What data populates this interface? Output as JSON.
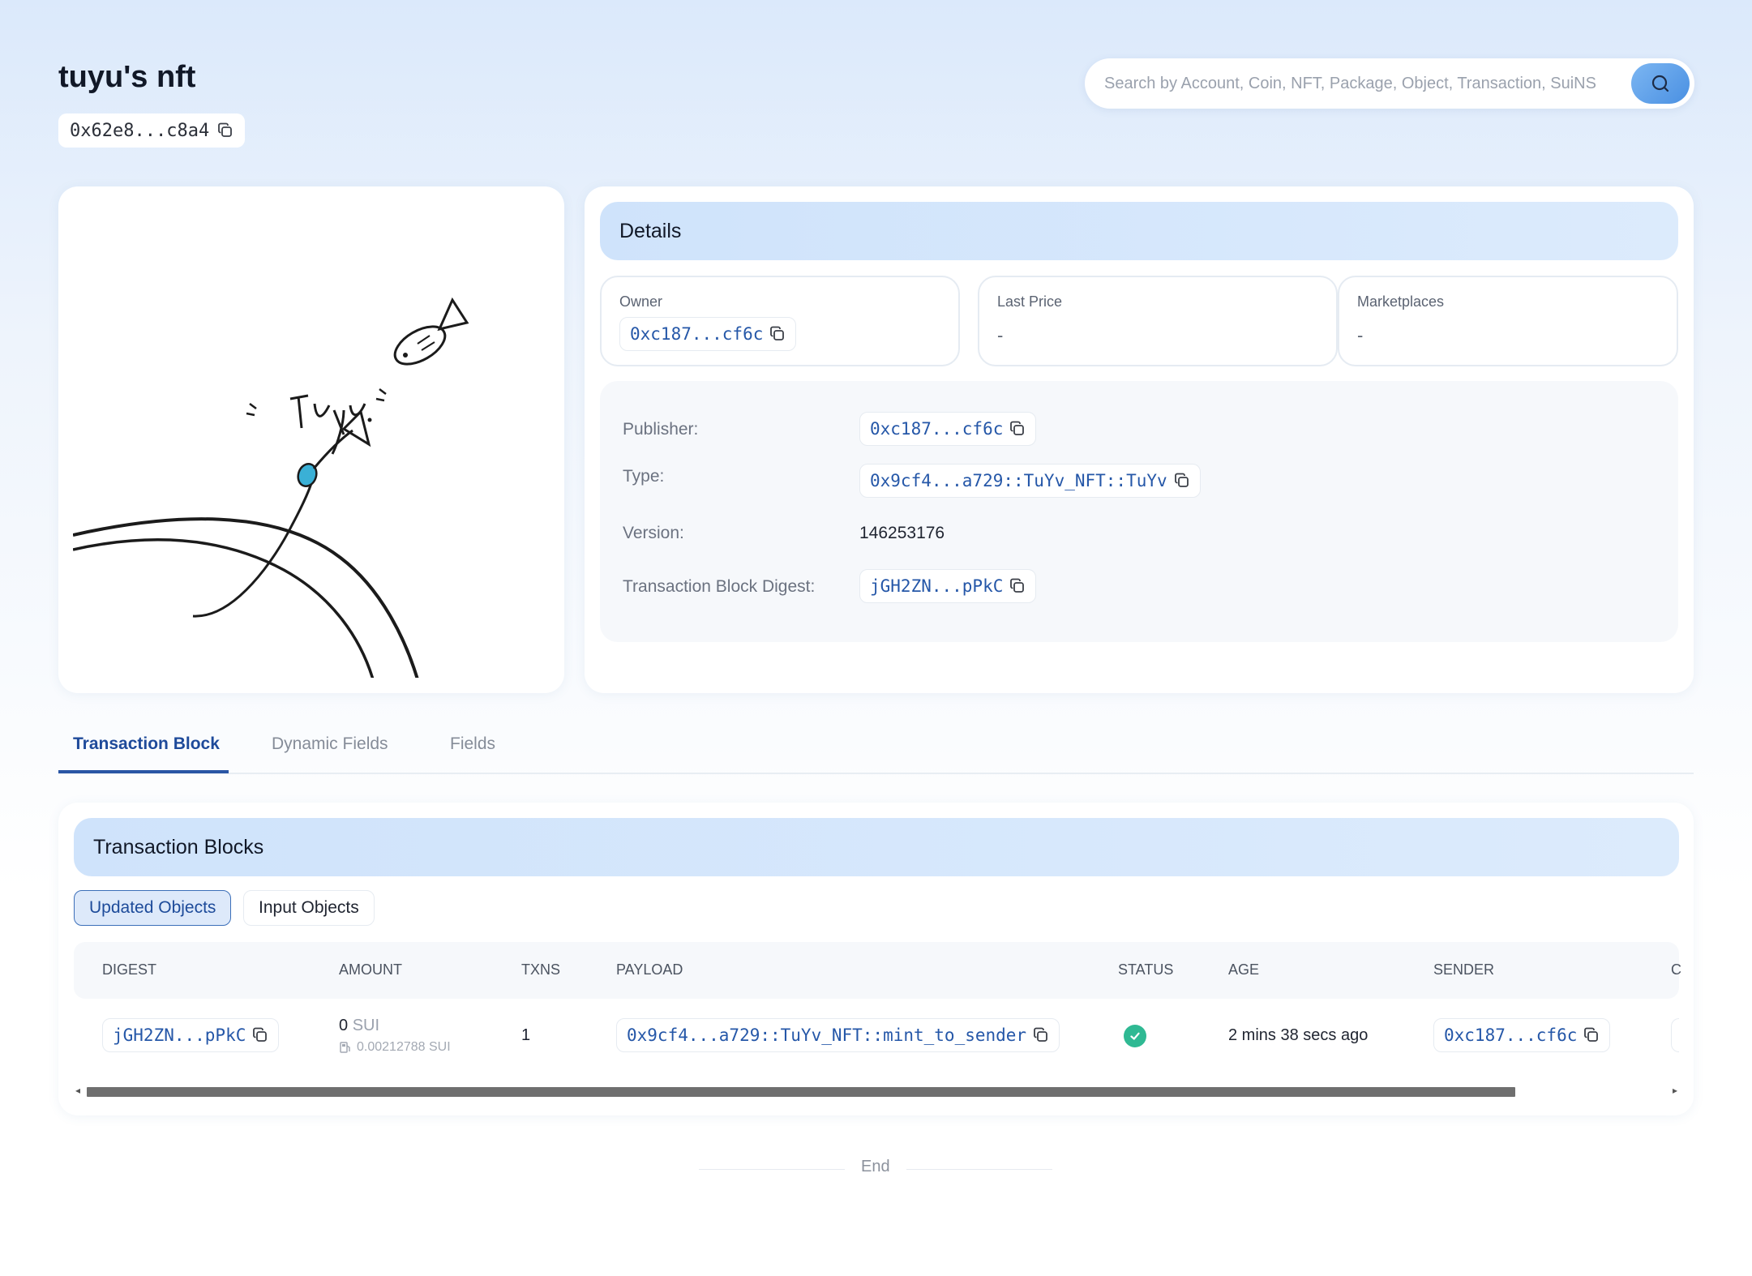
{
  "header": {
    "title": "tuyu's nft",
    "object_address": "0x62e8...c8a4",
    "search_placeholder": "Search by Account, Coin, NFT, Package, Object, Transaction, SuiNS"
  },
  "details": {
    "heading": "Details",
    "owner": {
      "label": "Owner",
      "value": "0xc187...cf6c"
    },
    "last_price": {
      "label": "Last Price",
      "value": "-"
    },
    "marketplaces": {
      "label": "Marketplaces",
      "value": "-"
    },
    "publisher": {
      "label": "Publisher:",
      "value": "0xc187...cf6c"
    },
    "type": {
      "label": "Type:",
      "value": "0x9cf4...a729::TuYv_NFT::TuYv"
    },
    "version": {
      "label": "Version:",
      "value": "146253176"
    },
    "digest": {
      "label": "Transaction Block Digest:",
      "value": "jGH2ZN...pPkC"
    }
  },
  "tabs": [
    "Transaction Block",
    "Dynamic Fields",
    "Fields"
  ],
  "transactions": {
    "heading": "Transaction Blocks",
    "filters": {
      "active": "Updated Objects",
      "inactive": "Input Objects"
    },
    "columns": [
      "DIGEST",
      "AMOUNT",
      "TXNS",
      "PAYLOAD",
      "STATUS",
      "AGE",
      "SENDER",
      "C"
    ],
    "rows": [
      {
        "digest": "jGH2ZN...pPkC",
        "amount": "0",
        "amount_unit": "SUI",
        "gas": "0.00212788 SUI",
        "txns": "1",
        "payload": "0x9cf4...a729::TuYv_NFT::mint_to_sender",
        "status": "success",
        "age": "2 mins 38 secs ago",
        "sender": "0xc187...cf6c"
      }
    ]
  },
  "footer": {
    "end_text": "End"
  },
  "colors": {
    "accent": "#2557a8",
    "success": "#2fb993",
    "fish": "#3ab0d6"
  }
}
